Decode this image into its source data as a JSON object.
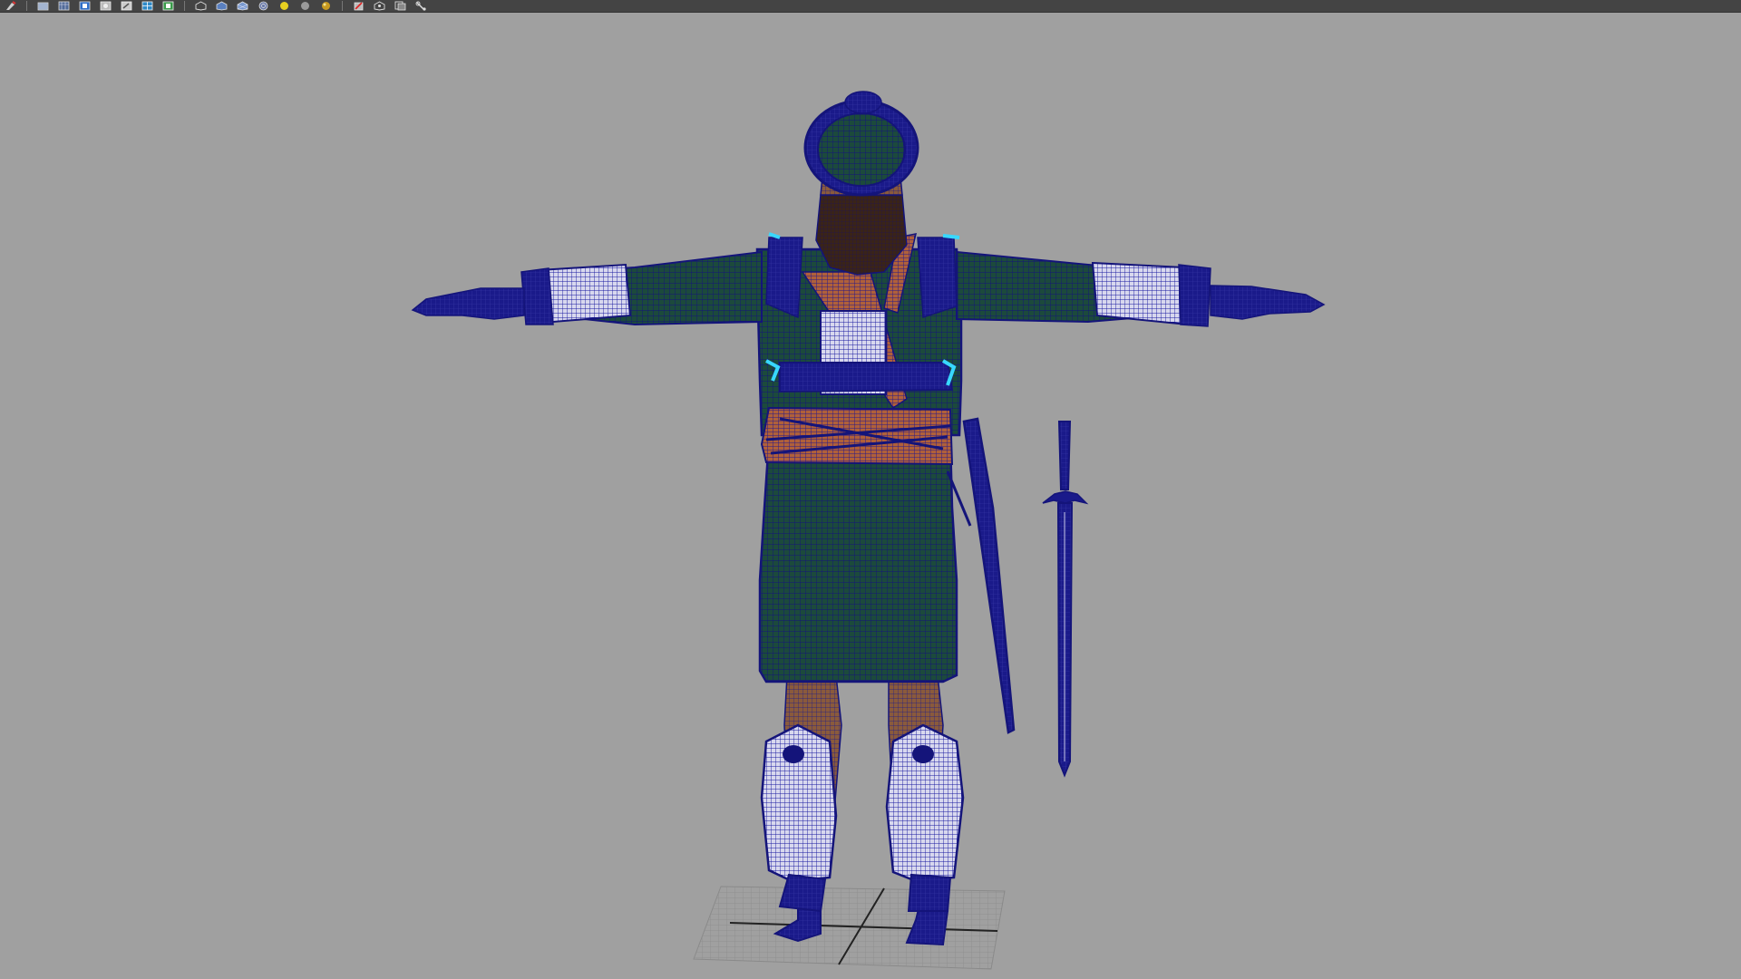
{
  "app": {
    "name": "",
    "viewport_background": "#a0a0a0"
  },
  "toolbar": {
    "groups": [
      {
        "icons": [
          "select-tool-icon"
        ]
      },
      {
        "icons": [
          "camera-attributes-icon",
          "image-plane-icon",
          "bookmark-icon",
          "2d-pan-zoom-icon",
          "grease-pencil-icon",
          "grid-icon",
          "film-gate-icon"
        ]
      },
      {
        "icons": [
          "wireframe-icon",
          "smooth-shade-icon",
          "wireframe-on-shaded-icon",
          "xray-icon",
          "use-default-light-icon",
          "shadows-icon",
          "ambient-occlusion-icon"
        ]
      },
      {
        "icons": [
          "isolate-select-icon",
          "xray-joints-icon",
          "snap-to-grid-icon"
        ]
      }
    ]
  },
  "scene": {
    "objects": [
      "character-mesh",
      "sword-scabbard-mesh",
      "sword-mesh",
      "ground-grid"
    ],
    "wireframe_color": "#1a1a9a",
    "selection_highlight_color": "#38d8ff",
    "cloth_color": "#1c4a3c",
    "skin_color": "#8a5a3c",
    "metal_color": "#d8d8ee"
  }
}
